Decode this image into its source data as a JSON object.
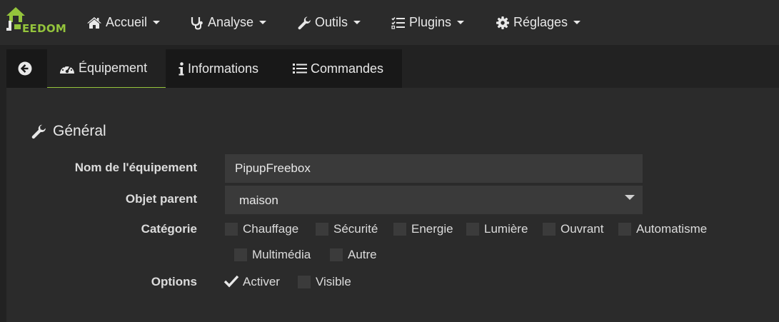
{
  "brand": {
    "name": "EEDOM",
    "accent": "#94c43c"
  },
  "nav": [
    {
      "label": "Accueil",
      "icon": "home-icon"
    },
    {
      "label": "Analyse",
      "icon": "stethoscope-icon"
    },
    {
      "label": "Outils",
      "icon": "wrench-icon"
    },
    {
      "label": "Plugins",
      "icon": "tasks-icon"
    },
    {
      "label": "Réglages",
      "icon": "gear-icon"
    }
  ],
  "tabs": {
    "back_icon": "arrow-circle-left-icon",
    "equipement": "Équipement",
    "informations": "Informations",
    "commandes": "Commandes",
    "active": "Équipement"
  },
  "general": {
    "title": "Général",
    "nom_label": "Nom de l'équipement",
    "nom_value": "PipupFreebox",
    "objet_label": "Objet parent",
    "objet_value": "maison",
    "categorie_label": "Catégorie",
    "categories": [
      {
        "label": "Chauffage",
        "checked": false
      },
      {
        "label": "Sécurité",
        "checked": false
      },
      {
        "label": "Energie",
        "checked": false
      },
      {
        "label": "Lumière",
        "checked": false
      },
      {
        "label": "Ouvrant",
        "checked": false
      },
      {
        "label": "Automatisme",
        "checked": false
      },
      {
        "label": "Multimédia",
        "checked": false
      },
      {
        "label": "Autre",
        "checked": false
      }
    ],
    "options_label": "Options",
    "options": [
      {
        "label": "Activer",
        "checked": true
      },
      {
        "label": "Visible",
        "checked": false
      }
    ]
  }
}
